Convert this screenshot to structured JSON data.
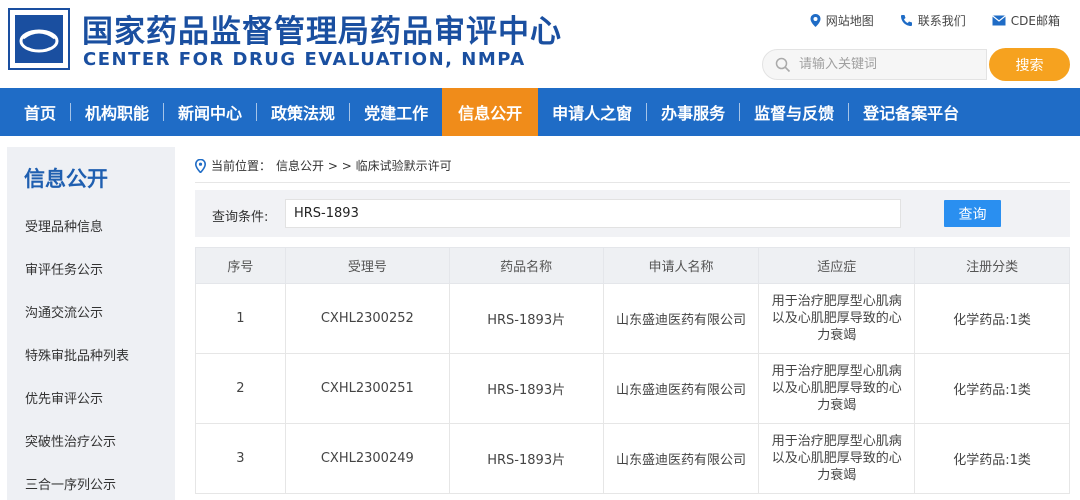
{
  "header": {
    "title_cn": "国家药品监督管理局药品审评中心",
    "title_en": "CENTER FOR DRUG EVALUATION, NMPA",
    "links": [
      {
        "label": "网站地图",
        "icon": "location-pin-icon"
      },
      {
        "label": "联系我们",
        "icon": "phone-icon"
      },
      {
        "label": "CDE邮箱",
        "icon": "mail-icon"
      }
    ],
    "search": {
      "placeholder": "请输入关键词",
      "button": "搜索"
    }
  },
  "nav": {
    "items": [
      "首页",
      "机构职能",
      "新闻中心",
      "政策法规",
      "党建工作",
      "信息公开",
      "申请人之窗",
      "办事服务",
      "监督与反馈",
      "登记备案平台"
    ],
    "active": "信息公开"
  },
  "sidebar": {
    "title": "信息公开",
    "items": [
      "受理品种信息",
      "审评任务公示",
      "沟通交流公示",
      "特殊审批品种列表",
      "优先审评公示",
      "突破性治疗公示",
      "三合一序列公示"
    ]
  },
  "breadcrumb": {
    "prefix": "当前位置：",
    "path": "信息公开 > > 临床试验默示许可"
  },
  "query": {
    "label": "查询条件:",
    "value": "HRS-1893",
    "button": "查询"
  },
  "table": {
    "headers": [
      "序号",
      "受理号",
      "药品名称",
      "申请人名称",
      "适应症",
      "注册分类"
    ],
    "rows": [
      {
        "no": "1",
        "accept_no": "CXHL2300252",
        "drug": "HRS-1893片",
        "applicant": "山东盛迪医药有限公司",
        "indication": "用于治疗肥厚型心肌病以及心肌肥厚导致的心力衰竭",
        "category": "化学药品:1类"
      },
      {
        "no": "2",
        "accept_no": "CXHL2300251",
        "drug": "HRS-1893片",
        "applicant": "山东盛迪医药有限公司",
        "indication": "用于治疗肥厚型心肌病以及心肌肥厚导致的心力衰竭",
        "category": "化学药品:1类"
      },
      {
        "no": "3",
        "accept_no": "CXHL2300249",
        "drug": "HRS-1893片",
        "applicant": "山东盛迪医药有限公司",
        "indication": "用于治疗肥厚型心肌病以及心肌肥厚导致的心力衰竭",
        "category": "化学药品:1类"
      }
    ]
  },
  "colors": {
    "brand_blue": "#1f6cc6",
    "title_blue": "#1a4fa0",
    "active_orange": "#f08c1a",
    "search_orange": "#f6a21f",
    "query_blue": "#2a8ff0"
  }
}
